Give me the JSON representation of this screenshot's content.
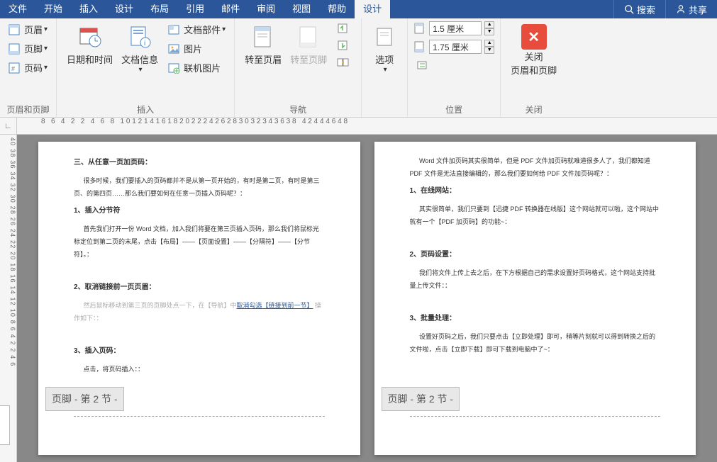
{
  "menu": {
    "file": "文件",
    "home": "开始",
    "insert": "插入",
    "design": "设计",
    "layout": "布局",
    "ref": "引用",
    "mail": "邮件",
    "review": "审阅",
    "view": "视图",
    "help": "帮助",
    "hf_design": "设计",
    "search": "搜索",
    "share": "共享"
  },
  "ribbon": {
    "header": "页眉",
    "footer": "页脚",
    "pagenum": "页码",
    "group_hf": "页眉和页脚",
    "datetime": "日期和时间",
    "docinfo": "文档信息",
    "docparts": "文档部件",
    "picture": "图片",
    "online_pic": "联机图片",
    "group_insert": "插入",
    "goto_header": "转至页眉",
    "goto_footer": "转至页脚",
    "group_nav": "导航",
    "options": "选项",
    "top_val": "1.5 厘米",
    "bottom_val": "1.75 厘米",
    "group_pos": "位置",
    "close_line1": "关闭",
    "close_line2": "页眉和页脚",
    "group_close": "关闭"
  },
  "hruler": "8 6 4 2   2 4 6 8 101214161820222426283032343638   42444648",
  "vruler": "40 38 36 34 32 30 28 26 24 22 20 18 16 14 12 10 8  6  4  2     2  4  6",
  "corner": "∟",
  "page1": {
    "t1": "三、从任意一页加页码：",
    "p1": "很多时候，我们要插入的页码都并不是从第一页开始的，有时是第二页，有时是第三页、的第四页……那么我们要如何在任意一页插入页码呢？：",
    "t2": "1、插入分节符",
    "p2": "首先我们打开一份 Word 文档，加入我们将要在第三页插入页码，那么我们将鼠标光标定位到第二页的末尾，点击【布局】——【页面设置】——【分隔符】——【分节符】。：",
    "t3": "2、取消链接前一页页眉：",
    "p3a": "然后鼠标移动到第三页的页脚处点一下，在【导航】中",
    "p3link": "取消勾选【链接到前一节】",
    "p3b": "操作如下：：",
    "t4": "3、插入页码：",
    "p4": "点击，将页码插入：：",
    "footer_tag": "页脚 - 第 2 节 -"
  },
  "page2": {
    "p0": "Word 文件加页码其实很简单，但是 PDF 文件加页码就难道很多人了，我们都知道 PDF 文件是无法直接编辑的，那么我们要如何给 PDF 文件加页码呢？：",
    "t1": "1、在线网站：",
    "p1": "其实很简单，我们只要到【迅捷 PDF 转换器在线版】这个网站就可以啦，这个网站中就有一个【PDF 加页码】的功能~：",
    "t2": "2、页码设置：",
    "p2": "我们将文件上传上去之后，在下方根据自己的需求设置好页码格式，这个网站支持批量上传文件：：",
    "t3": "3、批量处理：",
    "p3": "设置好页码之后，我们只要点击【立即处理】即可，稍等片刻就可以得到转换之后的文件啦，点击【立即下载】即可下载到电脑中了~：",
    "footer_tag": "页脚 - 第 2 节 -"
  }
}
